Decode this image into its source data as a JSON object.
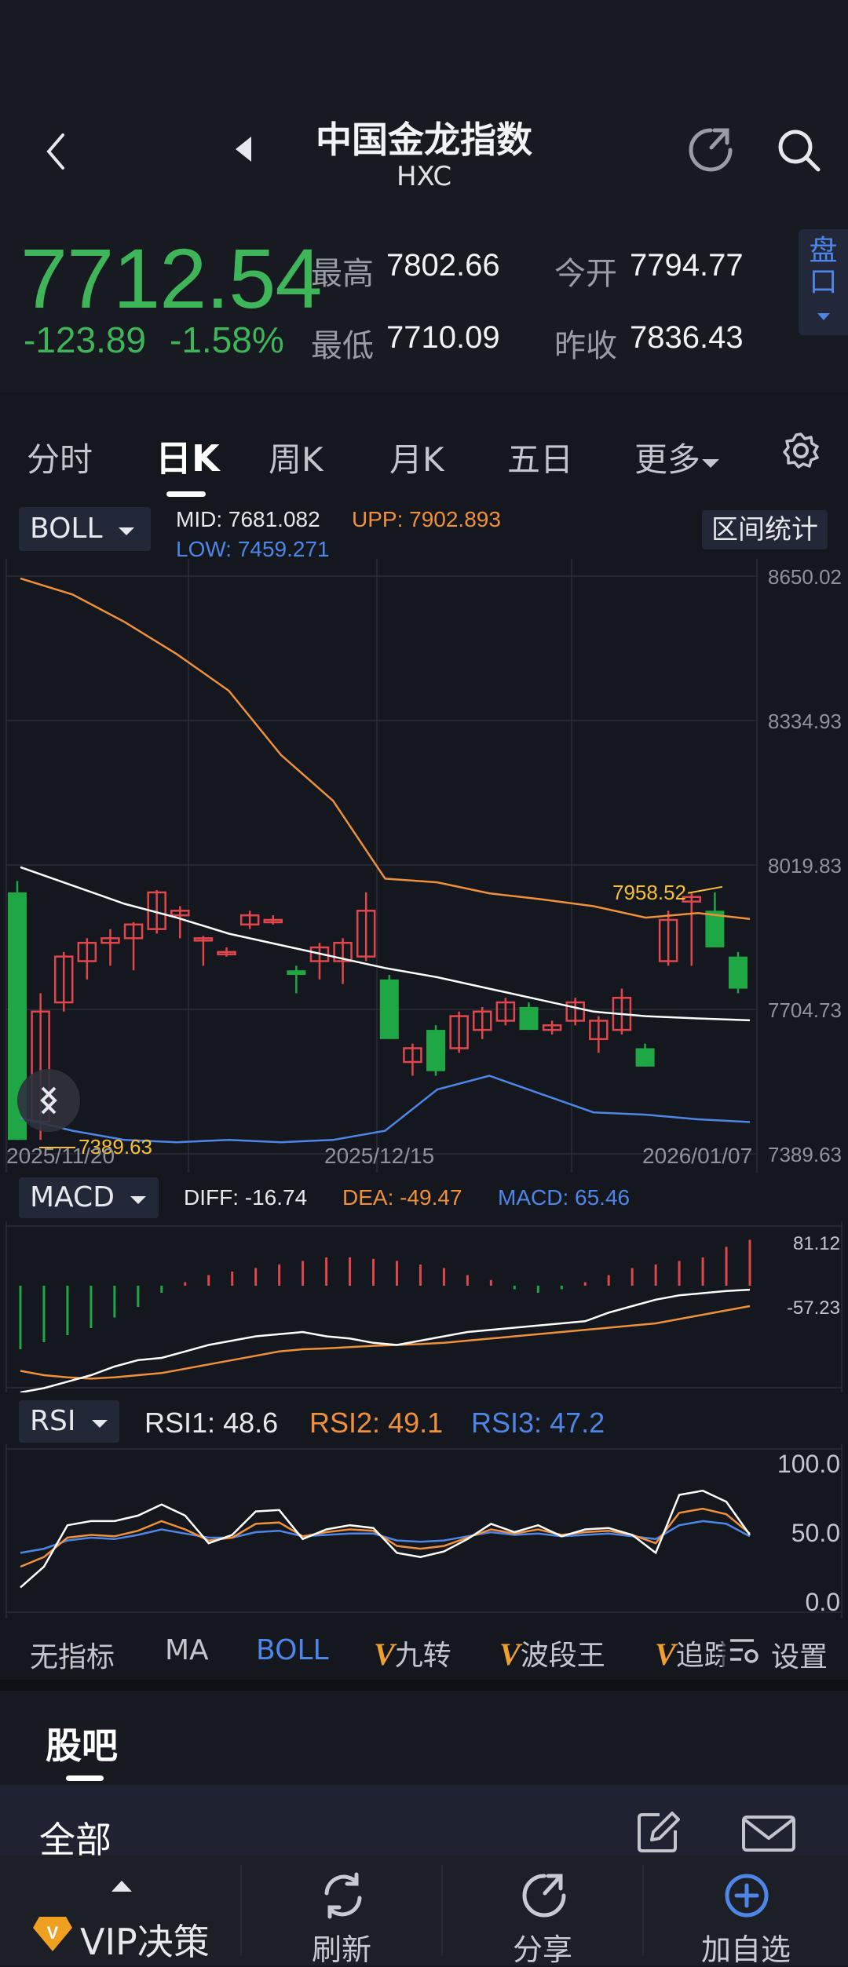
{
  "header": {
    "title": "中国金龙指数",
    "code": "HXC",
    "price": "7712.54",
    "change": "-123.89",
    "change_pct": "-1.58%",
    "stats": [
      {
        "label": "最高",
        "value": "7802.66"
      },
      {
        "label": "今开",
        "value": "7794.77"
      },
      {
        "label": "最低",
        "value": "7710.09"
      },
      {
        "label": "昨收",
        "value": "7836.43"
      }
    ],
    "pankou_line1": "盘",
    "pankou_line2": "口"
  },
  "tabs": [
    "分时",
    "日K",
    "周K",
    "月K",
    "五日",
    "更多"
  ],
  "active_tab": "日K",
  "boll": {
    "selector": "BOLL",
    "mid_label": "MID:",
    "mid": "7681.082",
    "upp_label": "UPP:",
    "upp": "7902.893",
    "low_label": "LOW:",
    "low": "7459.271",
    "range_stats_button": "区间统计"
  },
  "chart_data": [
    {
      "type": "candlestick",
      "y_ticks": [
        "8650.02",
        "8334.93",
        "8019.83",
        "7704.73",
        "7389.63"
      ],
      "ylim": [
        7389.63,
        8650.02
      ],
      "x_labels": [
        "2025/11/20",
        "2025/12/15",
        "2026/01/07"
      ],
      "annotations": [
        {
          "text": "7958.52",
          "kind": "high"
        },
        {
          "text": "7389.63",
          "kind": "low"
        }
      ],
      "candles": [
        [
          7960,
          7985,
          7420,
          7430
        ],
        [
          7460,
          7420,
          7700,
          7740
        ],
        [
          7720,
          7700,
          7820,
          7830
        ],
        [
          7810,
          7770,
          7850,
          7860
        ],
        [
          7850,
          7800,
          7860,
          7880
        ],
        [
          7860,
          7790,
          7890,
          7895
        ],
        [
          7880,
          7870,
          7960,
          7965
        ],
        [
          7910,
          7860,
          7920,
          7930
        ],
        [
          7860,
          7800,
          7860,
          7865
        ],
        [
          7830,
          7820,
          7830,
          7840
        ],
        [
          7890,
          7880,
          7910,
          7920
        ],
        [
          7900,
          7890,
          7900,
          7910
        ],
        [
          7790,
          7740,
          7780,
          7800
        ],
        [
          7810,
          7770,
          7840,
          7850
        ],
        [
          7810,
          7760,
          7850,
          7860
        ],
        [
          7820,
          7810,
          7920,
          7960
        ],
        [
          7770,
          7640,
          7640,
          7780
        ],
        [
          7590,
          7560,
          7620,
          7630
        ],
        [
          7660,
          7560,
          7570,
          7670
        ],
        [
          7620,
          7610,
          7690,
          7700
        ],
        [
          7660,
          7640,
          7700,
          7710
        ],
        [
          7680,
          7670,
          7720,
          7730
        ],
        [
          7710,
          7700,
          7660,
          7720
        ],
        [
          7660,
          7650,
          7670,
          7680
        ],
        [
          7680,
          7670,
          7720,
          7730
        ],
        [
          7640,
          7610,
          7680,
          7690
        ],
        [
          7660,
          7650,
          7730,
          7750
        ],
        [
          7620,
          7580,
          7580,
          7630
        ],
        [
          7810,
          7800,
          7900,
          7920
        ],
        [
          7940,
          7800,
          7950,
          7958
        ],
        [
          7920,
          7910,
          7840,
          7960
        ],
        [
          7820,
          7740,
          7750,
          7830
        ]
      ],
      "mid": [
        8015,
        7975,
        7935,
        7905,
        7870,
        7845,
        7820,
        7795,
        7775,
        7750,
        7725,
        7700,
        7690,
        7685,
        7681
      ],
      "upper": [
        8645,
        8610,
        8550,
        8480,
        8400,
        8260,
        8160,
        7990,
        7982,
        7958,
        7945,
        7930,
        7905,
        7915,
        7902
      ],
      "lower": [
        7468,
        7440,
        7420,
        7415,
        7420,
        7415,
        7420,
        7440,
        7530,
        7560,
        7520,
        7480,
        7475,
        7465,
        7459
      ]
    },
    {
      "type": "bar",
      "name": "MACD",
      "selector": "MACD",
      "diff_label": "DIFF:",
      "diff": "-16.74",
      "dea_label": "DEA:",
      "dea": "-49.47",
      "macd_label": "MACD:",
      "macd": "65.46",
      "y_ticks": [
        "81.12",
        "-57.23"
      ],
      "histogram": [
        -90,
        -80,
        -70,
        -60,
        -45,
        -30,
        -10,
        5,
        15,
        20,
        25,
        30,
        35,
        40,
        40,
        38,
        35,
        30,
        25,
        15,
        8,
        -5,
        -10,
        -5,
        5,
        15,
        25,
        30,
        35,
        40,
        55,
        65
      ],
      "diff_line": [
        -160,
        -150,
        -135,
        -120,
        -100,
        -85,
        -80,
        -65,
        -50,
        -40,
        -30,
        -25,
        -20,
        -30,
        -35,
        -45,
        -50,
        -40,
        -30,
        -20,
        -15,
        -10,
        -5,
        0,
        5,
        25,
        40,
        55,
        65,
        70,
        75,
        78
      ],
      "dea_line": [
        -110,
        -120,
        -125,
        -128,
        -125,
        -120,
        -115,
        -105,
        -95,
        -85,
        -75,
        -65,
        -60,
        -58,
        -55,
        -52,
        -50,
        -48,
        -45,
        -40,
        -35,
        -30,
        -25,
        -20,
        -15,
        -10,
        -5,
        0,
        10,
        20,
        30,
        40
      ]
    },
    {
      "type": "line",
      "name": "RSI",
      "selector": "RSI",
      "rsi1_label": "RSI1:",
      "rsi1": "48.6",
      "rsi2_label": "RSI2:",
      "rsi2": "49.1",
      "rsi3_label": "RSI3:",
      "rsi3": "47.2",
      "y_ticks": [
        "100.0",
        "50.0",
        "0.0"
      ],
      "ylim": [
        0,
        100
      ],
      "rsi1_line": [
        10,
        25,
        55,
        58,
        58,
        62,
        70,
        62,
        42,
        48,
        65,
        66,
        45,
        52,
        55,
        53,
        35,
        32,
        36,
        45,
        56,
        50,
        55,
        47,
        52,
        53,
        48,
        35,
        77,
        80,
        72,
        48
      ],
      "rsi2_line": [
        25,
        32,
        46,
        48,
        47,
        51,
        58,
        52,
        44,
        46,
        56,
        57,
        47,
        50,
        52,
        51,
        40,
        38,
        40,
        46,
        52,
        49,
        52,
        48,
        50,
        51,
        48,
        42,
        64,
        67,
        63,
        49
      ],
      "rsi3_line": [
        35,
        38,
        44,
        46,
        45,
        48,
        52,
        49,
        46,
        46,
        50,
        51,
        47,
        48,
        49,
        49,
        44,
        43,
        44,
        47,
        50,
        48,
        49,
        47,
        48,
        49,
        47,
        45,
        55,
        58,
        56,
        47
      ]
    }
  ],
  "indicator_bar": [
    "无指标",
    "MA",
    "BOLL",
    "九转",
    "波段王",
    "追踪",
    "设置"
  ],
  "guba": {
    "title": "股吧",
    "filter": "全部"
  },
  "bottom_nav": [
    "VIP决策",
    "刷新",
    "分享",
    "加自选"
  ],
  "colors": {
    "up": "#e0474c",
    "down": "#1fa745",
    "accent": "#4e86e8",
    "orange": "#f0903a",
    "yellow": "#f5c035"
  }
}
